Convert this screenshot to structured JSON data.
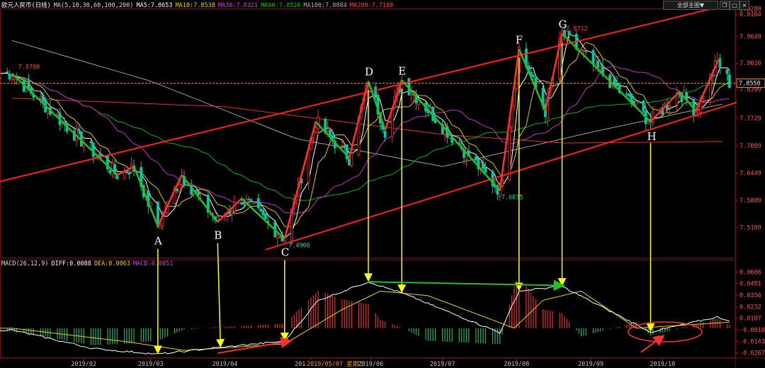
{
  "window": {
    "title": "欧元人民币(日线)",
    "top_menu_label": "全部主图▼",
    "icons": [
      "window-restore-icon",
      "window-maximize-icon",
      "window-close-icon"
    ]
  },
  "ma_legend": {
    "label": "MA(5,10,30,60,100,200)",
    "items": [
      {
        "text": "MA5:7.8653",
        "color": "#ffffff"
      },
      {
        "text": "MA10:7.8538",
        "color": "#e8d000"
      },
      {
        "text": "MA30:7.8321",
        "color": "#d040d0"
      },
      {
        "text": "MA60:7.8526",
        "color": "#00c000"
      },
      {
        "text": "MA100:7.8084",
        "color": "#b0b0b0"
      },
      {
        "text": "MA200:7.7188",
        "color": "#ff4040"
      }
    ]
  },
  "macd_legend": {
    "label": "MACD(26,12,9)",
    "items": [
      {
        "text": "DIFF:0.0088",
        "color": "#ffffff"
      },
      {
        "text": "DEA:0.0063",
        "color": "#e8d000"
      },
      {
        "text": "MACD:0.0051",
        "color": "#d040d0"
      }
    ]
  },
  "colors": {
    "up": "#ff3030",
    "down": "#00c8a0",
    "channel": "#ff2020",
    "wave_green": "#20c020",
    "wave_red": "#ff3030",
    "arrow": "#ffff00",
    "diff": "#ffffff",
    "dea": "#e8d000",
    "current_price": "#e8a000"
  },
  "chart_data": [
    {
      "type": "candlestick",
      "ylim": [
        7.45,
        8.03
      ],
      "y_ticks": [
        "8.0289",
        "8.0164",
        "7.9649",
        "7.9020",
        "7.8550",
        "7.8399",
        "7.7729",
        "7.7089",
        "7.6449",
        "7.5809",
        "7.5169"
      ],
      "x_ticks": [
        "2019/02",
        "2019/03",
        "2019/04",
        "2019/05/07 星期二",
        "2019/06",
        "2019/07",
        "2019/08",
        "2019/09",
        "2019/10"
      ],
      "x_tick_partial": "201",
      "current_price": 7.855,
      "current_price_label": "7.8550",
      "labeled_prices": [
        {
          "text": "7.8780",
          "value": 7.878
        },
        {
          "text": "7.4906",
          "value": 7.4906
        },
        {
          "text": "7.6035",
          "value": 7.6035
        },
        {
          "text": "7.9712",
          "value": 7.9712
        }
      ],
      "swing_points": [
        {
          "label": "A",
          "date": "2019/03/04",
          "value": 7.5169
        },
        {
          "label": "B",
          "date": "2019/03/29",
          "value": 7.53
        },
        {
          "label": "C",
          "date": "2019/04/26",
          "value": 7.4906
        },
        {
          "label": "D",
          "date": "2019/05/31",
          "value": 7.86
        },
        {
          "label": "E",
          "date": "2019/06/14",
          "value": 7.862
        },
        {
          "label": "F",
          "date": "2019/08/02",
          "value": 7.935
        },
        {
          "label": "G",
          "date": "2019/08/20",
          "value": 7.9712
        },
        {
          "label": "H",
          "date": "2019/09/26",
          "value": 7.765
        }
      ],
      "wave_path": [
        {
          "date": "2019/01/02",
          "value": 7.878
        },
        {
          "date": "2019/02/15",
          "value": 7.64
        },
        {
          "date": "2019/02/22",
          "value": 7.66
        },
        {
          "date": "2019/03/04",
          "value": 7.52
        },
        {
          "date": "2019/03/14",
          "value": 7.64
        },
        {
          "date": "2019/03/29",
          "value": 7.53
        },
        {
          "date": "2019/04/08",
          "value": 7.585
        },
        {
          "date": "2019/04/26",
          "value": 7.4906
        },
        {
          "date": "2019/05/09",
          "value": 7.765
        },
        {
          "date": "2019/05/23",
          "value": 7.68
        },
        {
          "date": "2019/05/31",
          "value": 7.86
        },
        {
          "date": "2019/06/07",
          "value": 7.745
        },
        {
          "date": "2019/06/14",
          "value": 7.862
        },
        {
          "date": "2019/07/25",
          "value": 7.6035
        },
        {
          "date": "2019/08/02",
          "value": 7.935
        },
        {
          "date": "2019/08/13",
          "value": 7.79
        },
        {
          "date": "2019/08/20",
          "value": 7.9712
        },
        {
          "date": "2019/09/26",
          "value": 7.765
        },
        {
          "date": "2019/10/08",
          "value": 7.835
        },
        {
          "date": "2019/10/15",
          "value": 7.79
        },
        {
          "date": "2019/10/24",
          "value": 7.905
        }
      ],
      "channel_upper": [
        {
          "date": "2018/12/28",
          "value": 7.625
        },
        {
          "date": "2019/10/22",
          "value": 8.03
        }
      ],
      "channel_lower": [
        {
          "date": "2019/04/18",
          "value": 7.465
        },
        {
          "date": "2019/11/01",
          "value": 7.81
        }
      ],
      "ma200_approx": [
        {
          "date": "2019/01/02",
          "value": 7.82
        },
        {
          "date": "2019/04/01",
          "value": 7.8
        },
        {
          "date": "2019/07/01",
          "value": 7.735
        },
        {
          "date": "2019/08/20",
          "value": 7.715
        },
        {
          "date": "2019/10/28",
          "value": 7.7188
        }
      ],
      "ma100_approx": [
        {
          "date": "2019/01/02",
          "value": 7.955
        },
        {
          "date": "2019/03/01",
          "value": 7.86
        },
        {
          "date": "2019/05/01",
          "value": 7.725
        },
        {
          "date": "2019/07/01",
          "value": 7.66
        },
        {
          "date": "2019/09/01",
          "value": 7.74
        },
        {
          "date": "2019/10/28",
          "value": 7.8084
        }
      ]
    },
    {
      "type": "macd",
      "ylim": [
        -0.03,
        0.07
      ],
      "y_ticks": [
        "0.0606",
        "0.0481",
        "0.0356",
        "0.0232",
        "0.0107",
        "-0.0018",
        "-0.0143",
        "-0.0267"
      ],
      "diff_key_points": [
        {
          "date": "2019/01/02",
          "value": -0.002
        },
        {
          "date": "2019/02/05",
          "value": -0.022
        },
        {
          "date": "2019/03/04",
          "value": -0.028
        },
        {
          "date": "2019/03/29",
          "value": -0.021
        },
        {
          "date": "2019/04/26",
          "value": -0.014
        },
        {
          "date": "2019/05/10",
          "value": 0.03
        },
        {
          "date": "2019/05/31",
          "value": 0.05
        },
        {
          "date": "2019/06/14",
          "value": 0.038
        },
        {
          "date": "2019/07/25",
          "value": -0.005
        },
        {
          "date": "2019/08/02",
          "value": 0.04
        },
        {
          "date": "2019/08/20",
          "value": 0.045
        },
        {
          "date": "2019/09/26",
          "value": -0.004
        },
        {
          "date": "2019/10/24",
          "value": 0.012
        },
        {
          "date": "2019/10/28",
          "value": 0.0088
        }
      ],
      "dea_key_points": [
        {
          "date": "2019/01/02",
          "value": 0.0
        },
        {
          "date": "2019/02/20",
          "value": -0.015
        },
        {
          "date": "2019/03/15",
          "value": -0.024
        },
        {
          "date": "2019/04/26",
          "value": -0.017
        },
        {
          "date": "2019/05/20",
          "value": 0.02
        },
        {
          "date": "2019/06/05",
          "value": 0.04
        },
        {
          "date": "2019/06/25",
          "value": 0.035
        },
        {
          "date": "2019/07/31",
          "value": 0.0
        },
        {
          "date": "2019/08/12",
          "value": 0.03
        },
        {
          "date": "2019/08/28",
          "value": 0.04
        },
        {
          "date": "2019/09/20",
          "value": 0.0
        },
        {
          "date": "2019/10/28",
          "value": 0.0063
        }
      ]
    }
  ]
}
